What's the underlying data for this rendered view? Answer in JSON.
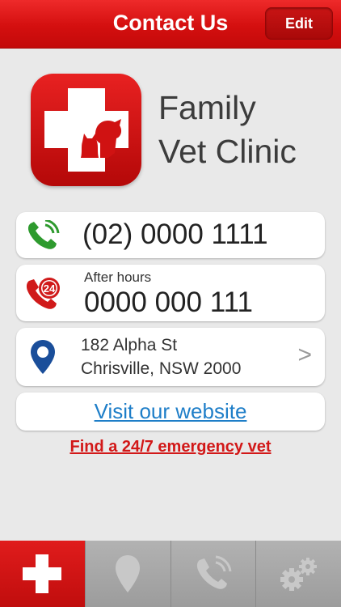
{
  "header": {
    "title": "Contact Us",
    "edit_label": "Edit"
  },
  "clinic": {
    "name_line1": "Family",
    "name_line2": "Vet Clinic"
  },
  "contacts": {
    "phone": "(02) 0000 1111",
    "after_hours_label": "After hours",
    "after_hours_number": "0000 000 111",
    "after_hours_badge": "24",
    "address_line1": "182 Alpha St",
    "address_line2": "Chrisville, NSW 2000",
    "address_chevron": ">",
    "website_label": "Visit our website"
  },
  "emergency_label": "Find a 24/7 emergency vet",
  "tabs": [
    {
      "icon": "cross-icon",
      "active": true
    },
    {
      "icon": "map-pin-icon",
      "active": false
    },
    {
      "icon": "phone-icon",
      "active": false
    },
    {
      "icon": "gears-icon",
      "active": false
    }
  ],
  "colors": {
    "brand_red": "#d40f0f",
    "link_blue": "#1e7ec8",
    "phone_green": "#2e9a2e",
    "pin_blue": "#1a4e9a",
    "tab_inactive": "#a6a6a6"
  }
}
